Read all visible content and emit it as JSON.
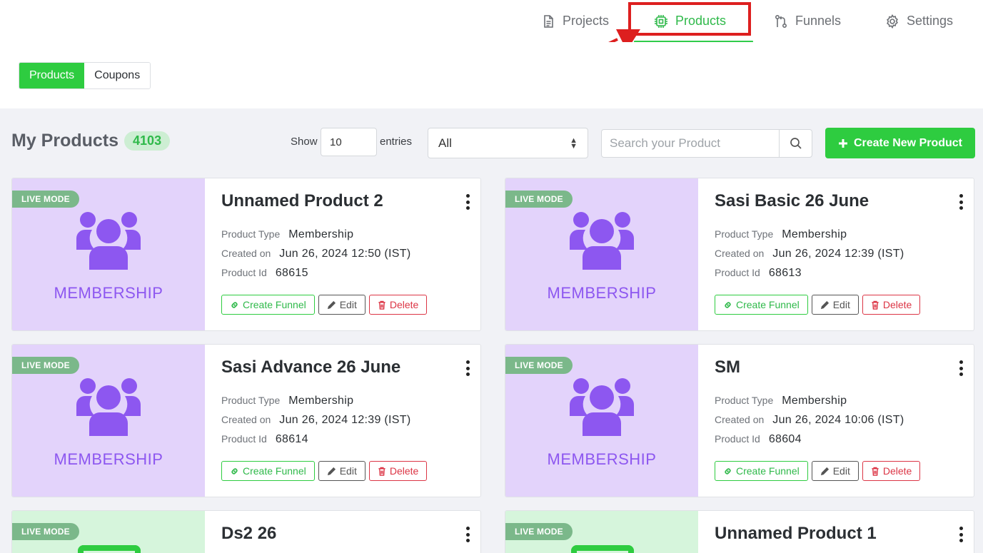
{
  "nav": {
    "items": [
      {
        "label": "Projects",
        "icon": "document-icon"
      },
      {
        "label": "Products",
        "icon": "chip-icon",
        "active": true
      },
      {
        "label": "Funnels",
        "icon": "funnel-flow-icon"
      },
      {
        "label": "Settings",
        "icon": "gear-icon"
      }
    ]
  },
  "subtabs": [
    {
      "label": "Products",
      "active": true
    },
    {
      "label": "Coupons"
    }
  ],
  "toolbar": {
    "title": "My Products",
    "count": "4103",
    "show_label": "Show",
    "entries_value": "10",
    "entries_label": "entries",
    "filter_value": "All",
    "search_placeholder": "Search your Product",
    "create_label": "Create New Product"
  },
  "labels": {
    "live_mode": "LIVE MODE",
    "product_type": "Product Type",
    "created_on": "Created on",
    "product_id": "Product Id",
    "create_funnel": "Create Funnel",
    "edit": "Edit",
    "delete": "Delete",
    "thumb_membership": "MEMBERSHIP"
  },
  "products": [
    {
      "title": "Unnamed Product 2",
      "type": "Membership",
      "created": "Jun 26, 2024 12:50 (IST)",
      "id": "68615"
    },
    {
      "title": "Sasi Basic 26 June",
      "type": "Membership",
      "created": "Jun 26, 2024 12:39 (IST)",
      "id": "68613"
    },
    {
      "title": "Sasi Advance 26 June",
      "type": "Membership",
      "created": "Jun 26, 2024 12:39 (IST)",
      "id": "68614"
    },
    {
      "title": "SM",
      "type": "Membership",
      "created": "Jun 26, 2024 10:06 (IST)",
      "id": "68604"
    },
    {
      "title": "Ds2 26"
    },
    {
      "title": "Unnamed Product 1"
    }
  ],
  "colors": {
    "accent": "#2ecc40",
    "annotation": "#dd1f1f",
    "membership_bg": "#e3d3fb",
    "membership_fg": "#8d57f0"
  }
}
